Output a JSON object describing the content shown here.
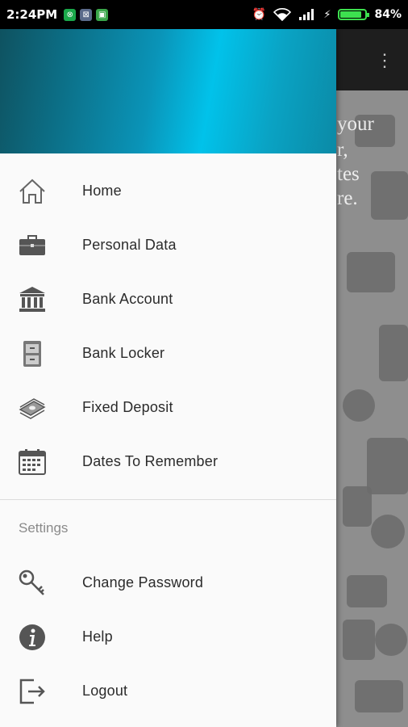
{
  "status_bar": {
    "time": "2:24PM",
    "battery_percent": "84%",
    "battery_level": 0.84,
    "icons": [
      "notification-app-icon",
      "notification-app-icon",
      "notification-app-icon",
      "alarm-icon",
      "wifi-icon",
      "signal-icon",
      "charging-icon",
      "battery-icon"
    ]
  },
  "background": {
    "lines": [
      "your",
      "r,",
      "tes",
      "re."
    ]
  },
  "drawer": {
    "header_gradient": [
      "#0e5260",
      "#01c2ea"
    ],
    "menu": [
      {
        "label": "Home",
        "icon": "home-icon"
      },
      {
        "label": "Personal Data",
        "icon": "briefcase-icon"
      },
      {
        "label": "Bank Account",
        "icon": "bank-icon"
      },
      {
        "label": "Bank Locker",
        "icon": "locker-icon"
      },
      {
        "label": "Fixed Deposit",
        "icon": "money-stack-icon"
      },
      {
        "label": "Dates To Remember",
        "icon": "calendar-icon"
      }
    ],
    "settings_label": "Settings",
    "settings": [
      {
        "label": "Change Password",
        "icon": "key-icon"
      },
      {
        "label": "Help",
        "icon": "info-icon"
      },
      {
        "label": "Logout",
        "icon": "logout-icon"
      }
    ]
  },
  "colors": {
    "accent": "#01c2ea",
    "battery": "#3de04f",
    "drawer_bg": "#fafafa",
    "text": "#2b2b2b",
    "section_text": "#8a8a8a"
  }
}
